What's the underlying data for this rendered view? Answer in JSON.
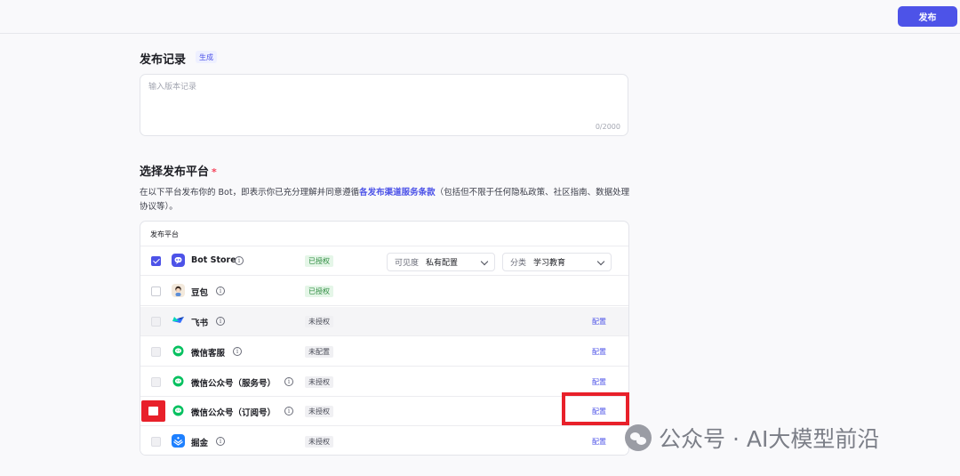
{
  "header": {
    "publish_label": "发布"
  },
  "record": {
    "title": "发布记录",
    "generate_label": "生成",
    "placeholder": "输入版本记录",
    "counter": "0/2000"
  },
  "platform": {
    "title": "选择发布平台",
    "required_mark": "*",
    "desc_before": "在以下平台发布你的 Bot，即表示你已充分理解并同意遵循",
    "desc_link": "各发布渠道服务条款",
    "desc_after": "（包括但不限于任何隐私政策、社区指南、数据处理协议等）。",
    "column_header": "发布平台",
    "visibility": {
      "label": "可见度",
      "value": "私有配置"
    },
    "category": {
      "label": "分类",
      "value": "学习教育"
    },
    "rows": [
      {
        "name": "Bot Store",
        "status": "已授权",
        "config": ""
      },
      {
        "name": "豆包",
        "status": "已授权",
        "config": ""
      },
      {
        "name": "飞书",
        "status": "未授权",
        "config": "配置"
      },
      {
        "name": "微信客服",
        "status": "未配置",
        "config": "配置"
      },
      {
        "name": "微信公众号（服务号）",
        "status": "未授权",
        "config": "配置"
      },
      {
        "name": "微信公众号（订阅号）",
        "status": "未授权",
        "config": "配置"
      },
      {
        "name": "掘金",
        "status": "未授权",
        "config": "配置"
      }
    ]
  },
  "watermark": {
    "text": "公众号 · AI大模型前沿"
  },
  "colors": {
    "accent": "#4d53e8",
    "highlight": "#e8202a",
    "authorized": "#2e8c40"
  }
}
